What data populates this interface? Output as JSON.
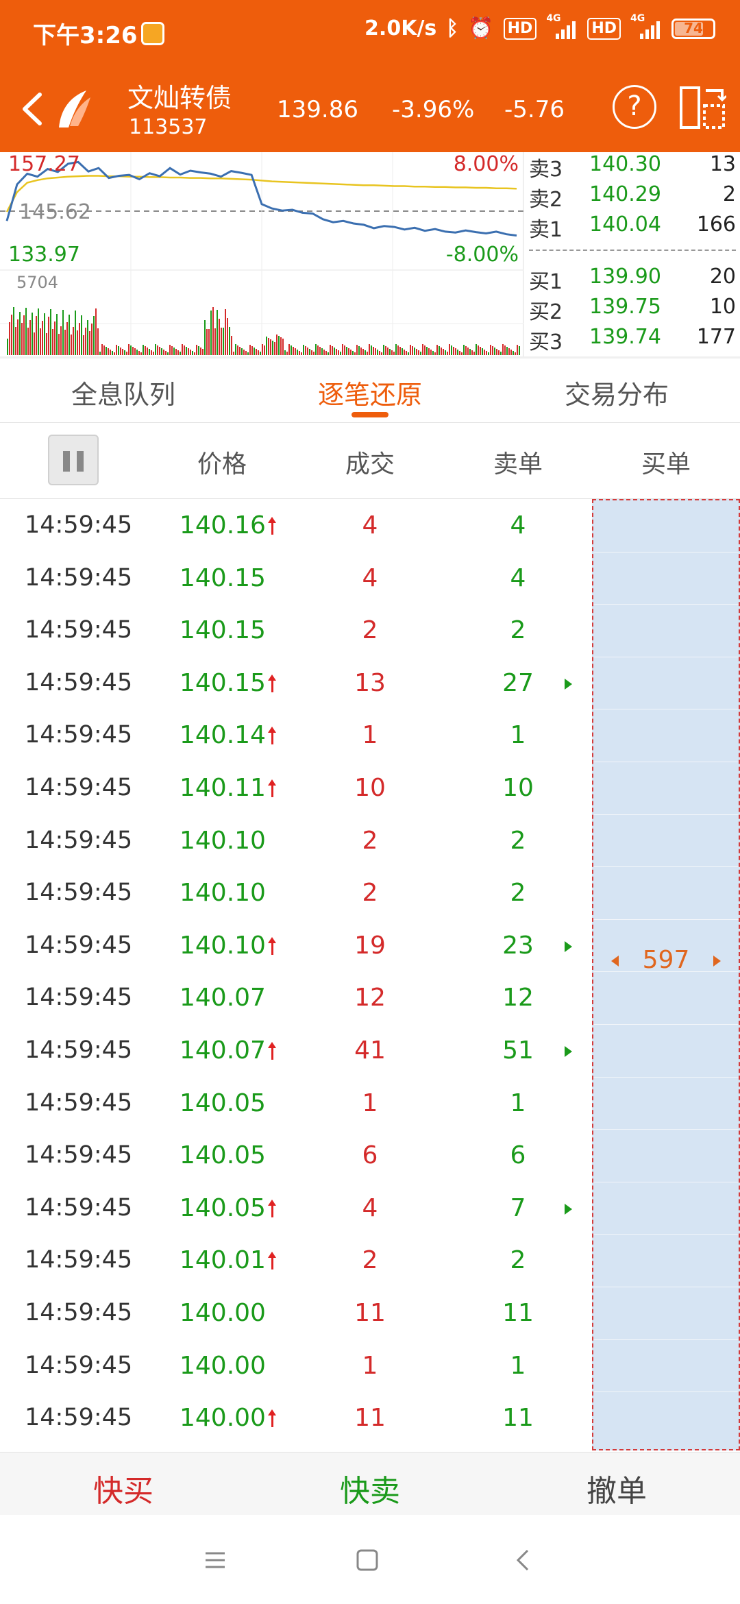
{
  "status_bar": {
    "time": "下午3:26",
    "net_speed": "2.0K/s",
    "hd1": "HD",
    "hd2": "HD",
    "net1": "4G",
    "net2": "4G",
    "battery": "74"
  },
  "header": {
    "stock_name": "文灿转债",
    "stock_code": "113537",
    "price": "139.86",
    "change_pct": "-3.96%",
    "change_amt": "-5.76",
    "help": "?"
  },
  "chart": {
    "high": "157.27",
    "mid": "145.62",
    "low": "133.97",
    "pct_up": "8.00%",
    "pct_down": "-8.00%",
    "vol_max": "5704",
    "price_series": [
      143.5,
      152.0,
      154.5,
      153.8,
      155.6,
      154.9,
      156.8,
      157.2,
      155.0,
      155.8,
      153.5,
      154.0,
      154.2,
      153.2,
      154.6,
      153.9,
      155.8,
      154.3,
      155.2,
      154.8,
      154.5,
      153.8,
      155.1,
      154.7,
      154.2,
      147.4,
      146.4,
      145.9,
      146.1,
      145.4,
      145.2,
      143.9,
      143.2,
      143.5,
      142.9,
      142.6,
      141.8,
      142.3,
      142.1,
      141.5,
      141.9,
      141.2,
      141.6,
      141.0,
      140.8,
      141.3,
      140.9,
      140.6,
      141.0,
      140.4,
      140.1
    ],
    "avg_series": [
      145.6,
      150.2,
      152.4,
      153.0,
      153.4,
      153.6,
      153.8,
      153.9,
      154.0,
      154.0,
      153.9,
      153.9,
      153.8,
      153.8,
      153.7,
      153.7,
      153.6,
      153.6,
      153.5,
      153.5,
      153.4,
      153.4,
      153.3,
      153.2,
      153.1,
      152.9,
      152.7,
      152.6,
      152.5,
      152.4,
      152.3,
      152.2,
      152.1,
      152.0,
      151.9,
      151.8,
      151.8,
      151.7,
      151.6,
      151.6,
      151.5,
      151.5,
      151.4,
      151.4,
      151.3,
      151.3,
      151.2,
      151.2,
      151.1,
      151.1,
      151.0
    ]
  },
  "depth": {
    "asks": [
      {
        "label": "卖3",
        "price": "140.30",
        "vol": "13"
      },
      {
        "label": "卖2",
        "price": "140.29",
        "vol": "2"
      },
      {
        "label": "卖1",
        "price": "140.04",
        "vol": "166"
      }
    ],
    "bids": [
      {
        "label": "买1",
        "price": "139.90",
        "vol": "20"
      },
      {
        "label": "买2",
        "price": "139.75",
        "vol": "10"
      },
      {
        "label": "买3",
        "price": "139.74",
        "vol": "177"
      }
    ]
  },
  "tabs": [
    "全息队列",
    "逐笔还原",
    "交易分布"
  ],
  "columns": [
    "价格",
    "成交",
    "卖单",
    "买单"
  ],
  "rows": [
    {
      "time": "14:59:45",
      "price": "140.16",
      "up": true,
      "deal": "4",
      "sell": "4",
      "more": false
    },
    {
      "time": "14:59:45",
      "price": "140.15",
      "up": false,
      "deal": "4",
      "sell": "4",
      "more": false
    },
    {
      "time": "14:59:45",
      "price": "140.15",
      "up": false,
      "deal": "2",
      "sell": "2",
      "more": false
    },
    {
      "time": "14:59:45",
      "price": "140.15",
      "up": true,
      "deal": "13",
      "sell": "27",
      "more": true
    },
    {
      "time": "14:59:45",
      "price": "140.14",
      "up": true,
      "deal": "1",
      "sell": "1",
      "more": false
    },
    {
      "time": "14:59:45",
      "price": "140.11",
      "up": true,
      "deal": "10",
      "sell": "10",
      "more": false
    },
    {
      "time": "14:59:45",
      "price": "140.10",
      "up": false,
      "deal": "2",
      "sell": "2",
      "more": false
    },
    {
      "time": "14:59:45",
      "price": "140.10",
      "up": false,
      "deal": "2",
      "sell": "2",
      "more": false
    },
    {
      "time": "14:59:45",
      "price": "140.10",
      "up": true,
      "deal": "19",
      "sell": "23",
      "more": true
    },
    {
      "time": "14:59:45",
      "price": "140.07",
      "up": false,
      "deal": "12",
      "sell": "12",
      "more": false
    },
    {
      "time": "14:59:45",
      "price": "140.07",
      "up": true,
      "deal": "41",
      "sell": "51",
      "more": true
    },
    {
      "time": "14:59:45",
      "price": "140.05",
      "up": false,
      "deal": "1",
      "sell": "1",
      "more": false
    },
    {
      "time": "14:59:45",
      "price": "140.05",
      "up": false,
      "deal": "6",
      "sell": "6",
      "more": false
    },
    {
      "time": "14:59:45",
      "price": "140.05",
      "up": true,
      "deal": "4",
      "sell": "7",
      "more": true
    },
    {
      "time": "14:59:45",
      "price": "140.01",
      "up": true,
      "deal": "2",
      "sell": "2",
      "more": false
    },
    {
      "time": "14:59:45",
      "price": "140.00",
      "up": false,
      "deal": "11",
      "sell": "11",
      "more": false
    },
    {
      "time": "14:59:45",
      "price": "140.00",
      "up": false,
      "deal": "1",
      "sell": "1",
      "more": false
    },
    {
      "time": "14:59:45",
      "price": "140.00",
      "up": true,
      "deal": "11",
      "sell": "11",
      "more": false
    }
  ],
  "buy_order": "597",
  "actions": {
    "quick_buy": "快买",
    "quick_sell": "快卖",
    "cancel": "撤单"
  },
  "colors": {
    "brand": "#ee5d0c",
    "up": "#d42a2a",
    "down": "#1a9a1a",
    "buy_bg": "#d6e4f3"
  }
}
